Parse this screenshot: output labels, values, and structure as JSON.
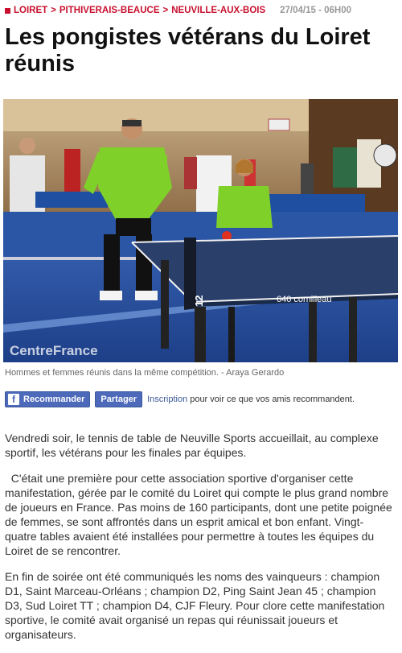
{
  "breadcrumb": {
    "items": [
      "LOIRET",
      "PITHIVERAIS-BEAUCE",
      "NEUVILLE-AUX-BOIS"
    ],
    "separator": ">",
    "date": "27/04/15 - 06H00"
  },
  "article": {
    "title": "Les pongistes vétérans du Loiret réunis",
    "photo_watermark": "CentreFrance",
    "photo_table_number": "12",
    "photo_table_brand": "640 cornilleau",
    "caption": "Hommes et femmes réunis dans la même compétition. - Araya Gerardo",
    "paragraphs": [
      "Vendredi soir, le tennis de table de Neuville Sports accueillait, au complexe sportif, les vétérans pour les finales par équipes.",
      "  C'était une première pour cette association sportive d'organiser cette manifestation, gérée par le comité du Loiret qui compte le plus grand nombre de joueurs en France. Pas moins de 160 participants, dont une petite poignée de femmes, se sont affrontés dans un esprit amical et bon enfant. Vingt-quatre tables avaient été installées pour permettre à toutes les équipes du Loiret de se rencontrer.",
      "En fin de soirée ont été communiqués les noms des vainqueurs : champion D1, Saint Marceau-Orléans ; champion D2, Ping Saint Jean 45 ; champion D3, Sud Loiret TT ; champion D4, CJF Fleury. Pour clore cette manifestation sportive, le comité avait organisé un repas qui réunissait joueurs et organisateurs."
    ]
  },
  "social": {
    "recommend_label": "Recommander",
    "share_label": "Partager",
    "login_link": "Inscription",
    "login_text": "pour voir ce que vos amis recommandent."
  },
  "colors": {
    "accent": "#c8102e",
    "facebook": "#4c69ba",
    "jersey": "#7fd12a"
  }
}
